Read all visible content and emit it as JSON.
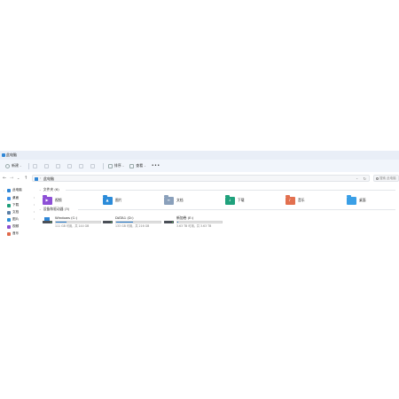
{
  "window": {
    "title": "此电脑"
  },
  "toolbar": {
    "new_label": "新建",
    "sort_label": "排序",
    "view_label": "查看",
    "more_label": "•••"
  },
  "nav": {
    "back": "←",
    "forward": "→",
    "up_chevron": "⌄",
    "up": "↑"
  },
  "address": {
    "chevron": "›",
    "path": "此电脑",
    "dropdown": "⌄",
    "refresh": "↻"
  },
  "search": {
    "placeholder": "搜索 此电脑"
  },
  "sidebar": {
    "items": [
      {
        "label": "此电脑",
        "icon": "pc-icon",
        "color": "#2f86d6"
      },
      {
        "label": "桌面",
        "icon": "desktop-icon",
        "color": "#3a8ee6"
      },
      {
        "label": "下载",
        "icon": "download-icon",
        "color": "#1e9e7a"
      },
      {
        "label": "文档",
        "icon": "document-icon",
        "color": "#5b7fa6"
      },
      {
        "label": "图片",
        "icon": "picture-icon",
        "color": "#2a8fd8"
      },
      {
        "label": "视频",
        "icon": "video-icon",
        "color": "#8a4fd0"
      },
      {
        "label": "音乐",
        "icon": "music-icon",
        "color": "#e0694a"
      }
    ]
  },
  "groups": {
    "folders": {
      "header": "文件夹 (6)"
    },
    "drives": {
      "header": "设备和驱动器 (3)"
    }
  },
  "folders": [
    {
      "label": "视频",
      "icon": "video-folder-icon",
      "color": "#8d4fd6",
      "emblem": "▶"
    },
    {
      "label": "图片",
      "icon": "picture-folder-icon",
      "color": "#2b8bd9",
      "emblem": "▲"
    },
    {
      "label": "文档",
      "icon": "document-folder-icon",
      "color": "#8aa0bb",
      "emblem": "≡"
    },
    {
      "label": "下载",
      "icon": "download-folder-icon",
      "color": "#1fa17c",
      "emblem": "↓"
    },
    {
      "label": "音乐",
      "icon": "music-folder-icon",
      "color": "#e2704f",
      "emblem": "♪"
    },
    {
      "label": "桌面",
      "icon": "desktop-folder-icon",
      "color": "#3a9fe6",
      "emblem": ""
    }
  ],
  "drives": [
    {
      "name": "Windows (C:)",
      "free_text": "111 GB 可用，共 144 GB",
      "used_fraction": 0.23
    },
    {
      "name": "DATA1 (D:)",
      "free_text": "133 GB 可用，共 216 GB",
      "used_fraction": 0.38
    },
    {
      "name": "新加卷 (E:)",
      "free_text": "3.63 TB 可用，共 3.63 TB",
      "used_fraction": 0.02
    }
  ]
}
